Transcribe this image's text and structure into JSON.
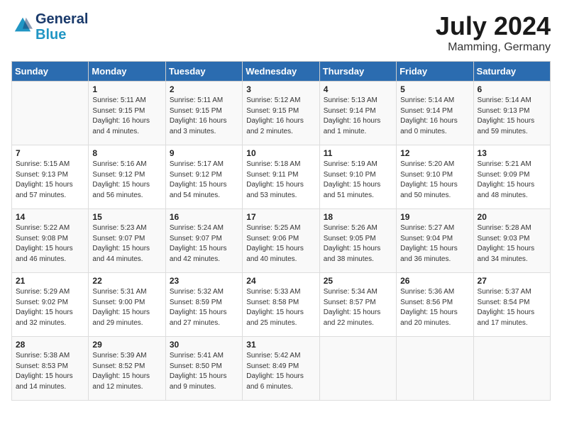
{
  "logo": {
    "line1": "General",
    "line2": "Blue"
  },
  "title": "July 2024",
  "location": "Mamming, Germany",
  "headers": [
    "Sunday",
    "Monday",
    "Tuesday",
    "Wednesday",
    "Thursday",
    "Friday",
    "Saturday"
  ],
  "weeks": [
    [
      {
        "day": "",
        "content": ""
      },
      {
        "day": "1",
        "content": "Sunrise: 5:11 AM\nSunset: 9:15 PM\nDaylight: 16 hours\nand 4 minutes."
      },
      {
        "day": "2",
        "content": "Sunrise: 5:11 AM\nSunset: 9:15 PM\nDaylight: 16 hours\nand 3 minutes."
      },
      {
        "day": "3",
        "content": "Sunrise: 5:12 AM\nSunset: 9:15 PM\nDaylight: 16 hours\nand 2 minutes."
      },
      {
        "day": "4",
        "content": "Sunrise: 5:13 AM\nSunset: 9:14 PM\nDaylight: 16 hours\nand 1 minute."
      },
      {
        "day": "5",
        "content": "Sunrise: 5:14 AM\nSunset: 9:14 PM\nDaylight: 16 hours\nand 0 minutes."
      },
      {
        "day": "6",
        "content": "Sunrise: 5:14 AM\nSunset: 9:13 PM\nDaylight: 15 hours\nand 59 minutes."
      }
    ],
    [
      {
        "day": "7",
        "content": "Sunrise: 5:15 AM\nSunset: 9:13 PM\nDaylight: 15 hours\nand 57 minutes."
      },
      {
        "day": "8",
        "content": "Sunrise: 5:16 AM\nSunset: 9:12 PM\nDaylight: 15 hours\nand 56 minutes."
      },
      {
        "day": "9",
        "content": "Sunrise: 5:17 AM\nSunset: 9:12 PM\nDaylight: 15 hours\nand 54 minutes."
      },
      {
        "day": "10",
        "content": "Sunrise: 5:18 AM\nSunset: 9:11 PM\nDaylight: 15 hours\nand 53 minutes."
      },
      {
        "day": "11",
        "content": "Sunrise: 5:19 AM\nSunset: 9:10 PM\nDaylight: 15 hours\nand 51 minutes."
      },
      {
        "day": "12",
        "content": "Sunrise: 5:20 AM\nSunset: 9:10 PM\nDaylight: 15 hours\nand 50 minutes."
      },
      {
        "day": "13",
        "content": "Sunrise: 5:21 AM\nSunset: 9:09 PM\nDaylight: 15 hours\nand 48 minutes."
      }
    ],
    [
      {
        "day": "14",
        "content": "Sunrise: 5:22 AM\nSunset: 9:08 PM\nDaylight: 15 hours\nand 46 minutes."
      },
      {
        "day": "15",
        "content": "Sunrise: 5:23 AM\nSunset: 9:07 PM\nDaylight: 15 hours\nand 44 minutes."
      },
      {
        "day": "16",
        "content": "Sunrise: 5:24 AM\nSunset: 9:07 PM\nDaylight: 15 hours\nand 42 minutes."
      },
      {
        "day": "17",
        "content": "Sunrise: 5:25 AM\nSunset: 9:06 PM\nDaylight: 15 hours\nand 40 minutes."
      },
      {
        "day": "18",
        "content": "Sunrise: 5:26 AM\nSunset: 9:05 PM\nDaylight: 15 hours\nand 38 minutes."
      },
      {
        "day": "19",
        "content": "Sunrise: 5:27 AM\nSunset: 9:04 PM\nDaylight: 15 hours\nand 36 minutes."
      },
      {
        "day": "20",
        "content": "Sunrise: 5:28 AM\nSunset: 9:03 PM\nDaylight: 15 hours\nand 34 minutes."
      }
    ],
    [
      {
        "day": "21",
        "content": "Sunrise: 5:29 AM\nSunset: 9:02 PM\nDaylight: 15 hours\nand 32 minutes."
      },
      {
        "day": "22",
        "content": "Sunrise: 5:31 AM\nSunset: 9:00 PM\nDaylight: 15 hours\nand 29 minutes."
      },
      {
        "day": "23",
        "content": "Sunrise: 5:32 AM\nSunset: 8:59 PM\nDaylight: 15 hours\nand 27 minutes."
      },
      {
        "day": "24",
        "content": "Sunrise: 5:33 AM\nSunset: 8:58 PM\nDaylight: 15 hours\nand 25 minutes."
      },
      {
        "day": "25",
        "content": "Sunrise: 5:34 AM\nSunset: 8:57 PM\nDaylight: 15 hours\nand 22 minutes."
      },
      {
        "day": "26",
        "content": "Sunrise: 5:36 AM\nSunset: 8:56 PM\nDaylight: 15 hours\nand 20 minutes."
      },
      {
        "day": "27",
        "content": "Sunrise: 5:37 AM\nSunset: 8:54 PM\nDaylight: 15 hours\nand 17 minutes."
      }
    ],
    [
      {
        "day": "28",
        "content": "Sunrise: 5:38 AM\nSunset: 8:53 PM\nDaylight: 15 hours\nand 14 minutes."
      },
      {
        "day": "29",
        "content": "Sunrise: 5:39 AM\nSunset: 8:52 PM\nDaylight: 15 hours\nand 12 minutes."
      },
      {
        "day": "30",
        "content": "Sunrise: 5:41 AM\nSunset: 8:50 PM\nDaylight: 15 hours\nand 9 minutes."
      },
      {
        "day": "31",
        "content": "Sunrise: 5:42 AM\nSunset: 8:49 PM\nDaylight: 15 hours\nand 6 minutes."
      },
      {
        "day": "",
        "content": ""
      },
      {
        "day": "",
        "content": ""
      },
      {
        "day": "",
        "content": ""
      }
    ]
  ]
}
